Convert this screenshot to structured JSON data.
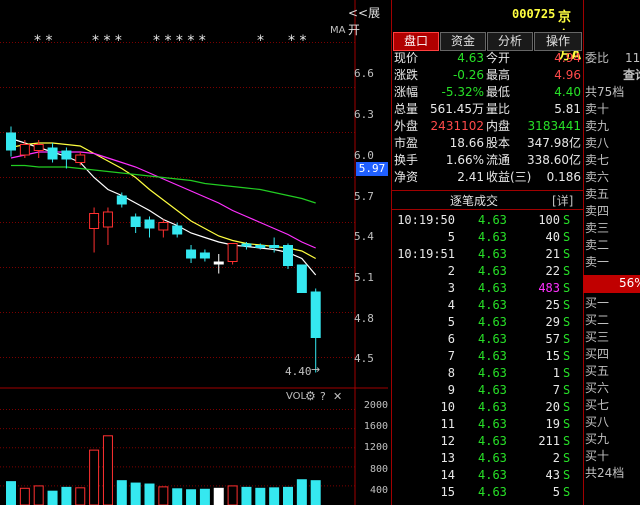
{
  "chart": {
    "expand_label": "<<展开",
    "ma_label": "MA",
    "price_axis": [
      "6.6",
      "6.3",
      "6.0",
      "5.7",
      "5.4",
      "5.1",
      "4.8",
      "4.5"
    ],
    "current_price_tag": "5.97",
    "low_marker": "4.40",
    "stars": [
      "* *",
      "* * *",
      "* * * * *",
      "*",
      "* *"
    ],
    "vol_label": "VOL",
    "vol_gear": "⚙",
    "vol_help": "?",
    "vol_close": "✕",
    "vol_axis": [
      "2000",
      "1600",
      "1200",
      "800",
      "400"
    ]
  },
  "chart_data": {
    "type": "candlestick",
    "candles": [
      {
        "o": 5.88,
        "c": 6.0,
        "h": 6.04,
        "l": 5.84,
        "dir": "down"
      },
      {
        "o": 5.85,
        "c": 5.92,
        "h": 5.95,
        "l": 5.83,
        "dir": "up"
      },
      {
        "o": 5.92,
        "c": 5.88,
        "h": 5.95,
        "l": 5.83,
        "dir": "up"
      },
      {
        "o": 5.82,
        "c": 5.9,
        "h": 5.93,
        "l": 5.8,
        "dir": "down"
      },
      {
        "o": 5.82,
        "c": 5.88,
        "h": 5.9,
        "l": 5.76,
        "dir": "down"
      },
      {
        "o": 5.8,
        "c": 5.85,
        "h": 5.87,
        "l": 5.78,
        "dir": "up"
      },
      {
        "o": 5.36,
        "c": 5.46,
        "h": 5.5,
        "l": 5.2,
        "dir": "up"
      },
      {
        "o": 5.37,
        "c": 5.47,
        "h": 5.5,
        "l": 5.25,
        "dir": "up"
      },
      {
        "o": 5.52,
        "c": 5.58,
        "h": 5.6,
        "l": 5.5,
        "dir": "down"
      },
      {
        "o": 5.37,
        "c": 5.44,
        "h": 5.46,
        "l": 5.33,
        "dir": "down"
      },
      {
        "o": 5.36,
        "c": 5.42,
        "h": 5.44,
        "l": 5.3,
        "dir": "down"
      },
      {
        "o": 5.35,
        "c": 5.4,
        "h": 5.42,
        "l": 5.3,
        "dir": "up"
      },
      {
        "o": 5.32,
        "c": 5.38,
        "h": 5.4,
        "l": 5.3,
        "dir": "down"
      },
      {
        "o": 5.16,
        "c": 5.22,
        "h": 5.25,
        "l": 5.13,
        "dir": "down"
      },
      {
        "o": 5.16,
        "c": 5.2,
        "h": 5.22,
        "l": 5.14,
        "dir": "down"
      },
      {
        "o": 5.12,
        "c": 5.14,
        "h": 5.19,
        "l": 5.06,
        "dir": "flat"
      },
      {
        "o": 5.14,
        "c": 5.26,
        "h": 5.26,
        "l": 5.12,
        "dir": "up"
      },
      {
        "o": 5.24,
        "c": 5.26,
        "h": 5.27,
        "l": 5.22,
        "dir": "down"
      },
      {
        "o": 5.23,
        "c": 5.25,
        "h": 5.26,
        "l": 5.22,
        "dir": "down"
      },
      {
        "o": 5.23,
        "c": 5.25,
        "h": 5.3,
        "l": 5.2,
        "dir": "down"
      },
      {
        "o": 5.11,
        "c": 5.25,
        "h": 5.26,
        "l": 5.09,
        "dir": "down"
      },
      {
        "o": 4.93,
        "c": 5.12,
        "h": 5.12,
        "l": 4.93,
        "dir": "down"
      },
      {
        "o": 4.63,
        "c": 4.94,
        "h": 4.96,
        "l": 4.4,
        "dir": "down"
      }
    ],
    "ma_lines": [
      {
        "color": "#ffffff",
        "values": [
          5.96,
          5.93,
          5.9,
          5.87,
          5.84,
          5.8,
          5.7,
          5.62,
          5.58,
          5.53,
          5.48,
          5.42,
          5.38,
          5.33,
          5.3,
          5.27,
          5.25,
          5.24,
          5.23,
          5.22,
          5.2,
          5.16,
          5.05
        ]
      },
      {
        "color": "#ffff40",
        "values": [
          5.9,
          5.92,
          5.93,
          5.93,
          5.92,
          5.91,
          5.86,
          5.81,
          5.76,
          5.7,
          5.62,
          5.55,
          5.48,
          5.41,
          5.36,
          5.31,
          5.28,
          5.26,
          5.25,
          5.24,
          5.23,
          5.21,
          5.16
        ]
      },
      {
        "color": "#ff30ff",
        "values": [
          5.83,
          5.85,
          5.87,
          5.87,
          5.87,
          5.87,
          5.86,
          5.83,
          5.8,
          5.77,
          5.73,
          5.69,
          5.65,
          5.61,
          5.57,
          5.53,
          5.48,
          5.44,
          5.4,
          5.36,
          5.32,
          5.27,
          5.23
        ]
      },
      {
        "color": "#22cc22",
        "values": [
          5.78,
          5.78,
          5.77,
          5.77,
          5.77,
          5.76,
          5.75,
          5.74,
          5.73,
          5.72,
          5.71,
          5.7,
          5.69,
          5.68,
          5.66,
          5.65,
          5.64,
          5.63,
          5.62,
          5.6,
          5.58,
          5.56,
          5.53
        ]
      }
    ],
    "volume": [
      500,
      350,
      400,
      300,
      380,
      360,
      1150,
      1450,
      520,
      470,
      450,
      380,
      350,
      330,
      340,
      360,
      400,
      380,
      360,
      370,
      380,
      540,
      520
    ],
    "volume_dir": [
      "down",
      "up",
      "up",
      "down",
      "down",
      "up",
      "up",
      "up",
      "down",
      "down",
      "down",
      "up",
      "down",
      "down",
      "down",
      "flat",
      "up",
      "down",
      "down",
      "down",
      "down",
      "down",
      "down"
    ],
    "ylim": [
      4.35,
      6.75
    ],
    "vol_ylim": [
      0,
      2200
    ]
  },
  "header": {
    "code": "000725",
    "name": "京东方A"
  },
  "tabs": [
    "盘口",
    "资金",
    "分析",
    "操作"
  ],
  "quote": [
    {
      "l1": "现价",
      "v1": "4.63",
      "c1": "green",
      "l2": "今开",
      "v2": "4.94",
      "c2": "red"
    },
    {
      "l1": "涨跌",
      "v1": "-0.26",
      "c1": "green",
      "l2": "最高",
      "v2": "4.96",
      "c2": "red"
    },
    {
      "l1": "涨幅",
      "v1": "-5.32%",
      "c1": "green",
      "l2": "最低",
      "v2": "4.40",
      "c2": "green"
    },
    {
      "l1": "总量",
      "v1": "561.45万",
      "c1": "white",
      "l2": "量比",
      "v2": "5.81",
      "c2": "white"
    },
    {
      "l1": "外盘",
      "v1": "2431102",
      "c1": "red",
      "l2": "内盘",
      "v2": "3183441",
      "c2": "green"
    },
    {
      "l1": "市盈",
      "v1": "18.66",
      "c1": "white",
      "l2": "股本",
      "v2": "347.98亿",
      "c2": "white"
    },
    {
      "l1": "换手",
      "v1": "1.66%",
      "c1": "white",
      "l2": "流通",
      "v2": "338.60亿",
      "c2": "white"
    },
    {
      "l1": "净资",
      "v1": "2.41",
      "c1": "white",
      "l2": "收益(三)",
      "v2": "0.186",
      "c2": "white"
    }
  ],
  "trades_header": {
    "title": "逐笔成交",
    "detail": "[详]"
  },
  "trades": [
    {
      "time": "10:19:50",
      "price": "4.63",
      "vol": "100",
      "side": "S",
      "vc": "white"
    },
    {
      "time": "5",
      "price": "4.63",
      "vol": "40",
      "side": "S",
      "vc": "white"
    },
    {
      "time": "10:19:51",
      "price": "4.63",
      "vol": "21",
      "side": "S",
      "vc": "white"
    },
    {
      "time": "2",
      "price": "4.63",
      "vol": "22",
      "side": "S",
      "vc": "white"
    },
    {
      "time": "3",
      "price": "4.63",
      "vol": "483",
      "side": "S",
      "vc": "magenta"
    },
    {
      "time": "4",
      "price": "4.63",
      "vol": "25",
      "side": "S",
      "vc": "white"
    },
    {
      "time": "5",
      "price": "4.63",
      "vol": "29",
      "side": "S",
      "vc": "white"
    },
    {
      "time": "6",
      "price": "4.63",
      "vol": "57",
      "side": "S",
      "vc": "white"
    },
    {
      "time": "7",
      "price": "4.63",
      "vol": "15",
      "side": "S",
      "vc": "white"
    },
    {
      "time": "8",
      "price": "4.63",
      "vol": "1",
      "side": "S",
      "vc": "white"
    },
    {
      "time": "9",
      "price": "4.63",
      "vol": "7",
      "side": "S",
      "vc": "white"
    },
    {
      "time": "10",
      "price": "4.63",
      "vol": "20",
      "side": "S",
      "vc": "white"
    },
    {
      "time": "11",
      "price": "4.63",
      "vol": "19",
      "side": "S",
      "vc": "white"
    },
    {
      "time": "12",
      "price": "4.63",
      "vol": "211",
      "side": "S",
      "vc": "white"
    },
    {
      "time": "13",
      "price": "4.63",
      "vol": "2",
      "side": "S",
      "vc": "white"
    },
    {
      "time": "14",
      "price": "4.63",
      "vol": "43",
      "side": "S",
      "vc": "white"
    },
    {
      "time": "15",
      "price": "4.63",
      "vol": "5",
      "side": "S",
      "vc": "white"
    }
  ],
  "book": {
    "weibi": "委比",
    "weibi_val": "11",
    "query": "查询",
    "sell_total": "共75档",
    "sells": [
      "卖十",
      "卖九",
      "卖八",
      "卖七",
      "卖六",
      "卖五",
      "卖四",
      "卖三",
      "卖二",
      "卖一"
    ],
    "ratio": "56%",
    "buys": [
      "买一",
      "买二",
      "买三",
      "买四",
      "买五",
      "买六",
      "买七",
      "买八",
      "买九",
      "买十"
    ],
    "buy_total": "共24档"
  }
}
